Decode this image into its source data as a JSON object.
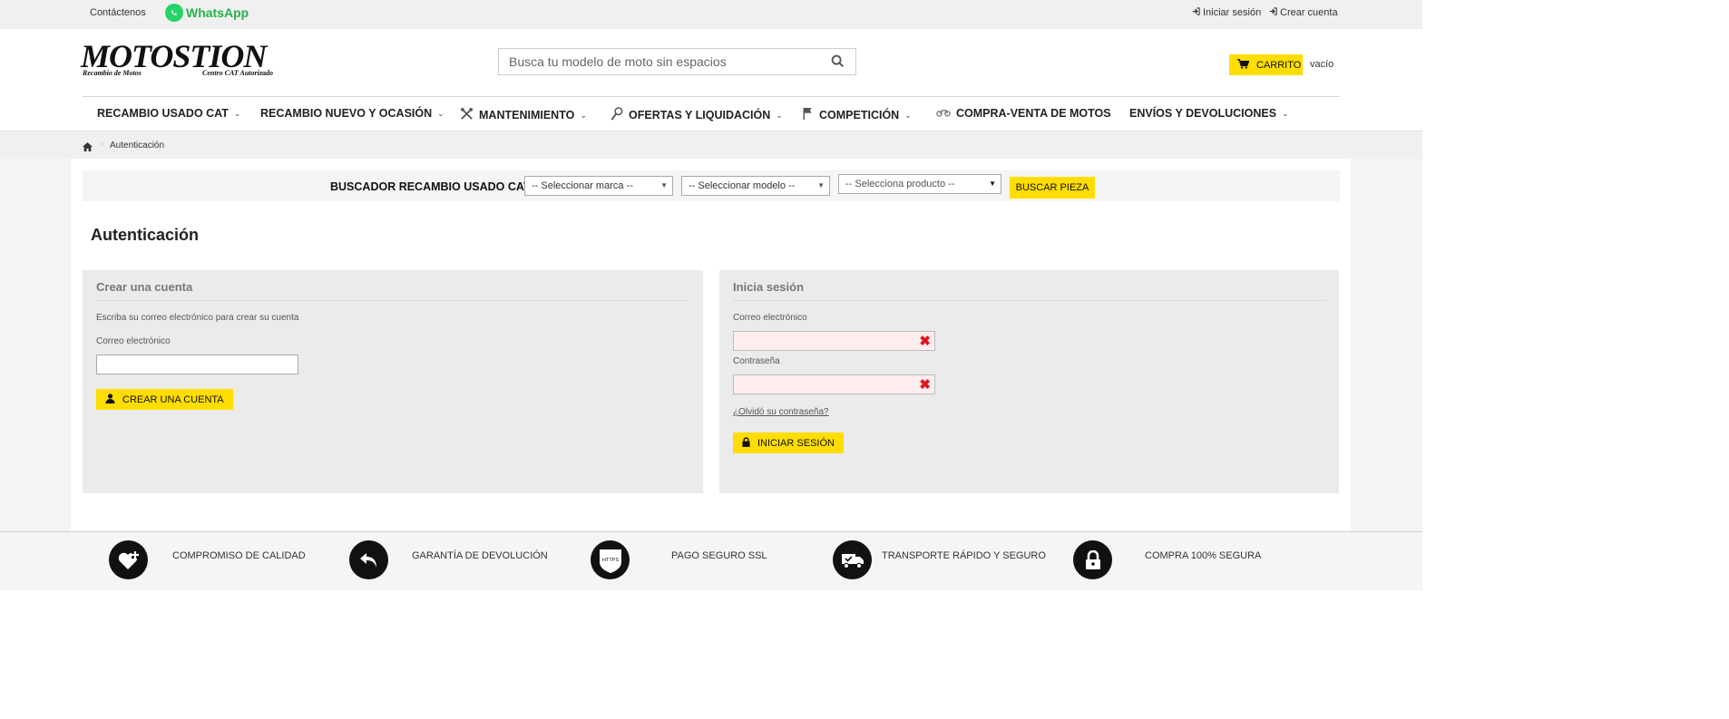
{
  "topbar": {
    "contact_label": "Contáctenos",
    "whatsapp_label": "WhatsApp",
    "login_label": "Iniciar sesión",
    "register_label": "Crear cuenta"
  },
  "header": {
    "logo_text": "MOTOSTION",
    "logo_tagline_left": "Recambio de Motos",
    "logo_tagline_right": "Centro CAT Autorizado",
    "search_placeholder": "Busca tu modelo de moto sin espacios",
    "cart_label": "CARRITO",
    "cart_status": "vacío"
  },
  "nav": {
    "items": [
      {
        "label": "RECAMBIO USADO CAT",
        "icon": "",
        "dropdown": true
      },
      {
        "label": "RECAMBIO NUEVO Y OCASIÓN",
        "icon": "",
        "dropdown": true
      },
      {
        "label": "MANTENIMIENTO",
        "icon": "tools-icon",
        "dropdown": true
      },
      {
        "label": "OFERTAS Y LIQUIDACIÓN",
        "icon": "tag-icon",
        "dropdown": true
      },
      {
        "label": "COMPETICIÓN",
        "icon": "flag-icon",
        "dropdown": true
      },
      {
        "label": "COMPRA-VENTA DE MOTOS",
        "icon": "motorcycle-icon",
        "dropdown": false
      },
      {
        "label": "ENVÍOS Y DEVOLUCIONES",
        "icon": "",
        "dropdown": true
      }
    ]
  },
  "breadcrumb": {
    "current": "Autenticación"
  },
  "finder": {
    "label": "BUSCADOR RECAMBIO USADO CAT:",
    "brand_select": "-- Seleccionar marca --",
    "model_select": "-- Seleccionar modelo --",
    "product_select": "-- Selecciona producto --",
    "button_label": "BUSCAR PIEZA"
  },
  "page": {
    "title": "Autenticación"
  },
  "create_account": {
    "heading": "Crear una cuenta",
    "intro": "Escriba su correo electrónico para crear su cuenta",
    "email_label": "Correo electrónico",
    "email_value": "",
    "button_label": "CREAR UNA CUENTA"
  },
  "login": {
    "heading": "Inicia sesión",
    "email_label": "Correo electrónico",
    "email_value": "",
    "password_label": "Contraseña",
    "password_value": "",
    "forgot_label": "¿Olvidó su contraseña?",
    "button_label": "INICIAR SESIÓN",
    "field_error_color": "#e0161e"
  },
  "footer": {
    "features": [
      {
        "label": "COMPROMISO DE CALIDAD",
        "icon": "heart-plus-icon"
      },
      {
        "label": "GARANTÍA DE DEVOLUCIÓN",
        "icon": "return-arrow-icon"
      },
      {
        "label": "PAGO SEGURO SSL",
        "icon": "https-shield-icon"
      },
      {
        "label": "TRANSPORTE RÁPIDO Y SEGURO",
        "icon": "delivery-truck-icon"
      },
      {
        "label": "COMPRA 100% SEGURA",
        "icon": "padlock-icon"
      }
    ],
    "https_badge_text": "HTTPS"
  },
  "colors": {
    "accent": "#ffdd00",
    "whatsapp": "#25d366",
    "error": "#e0161e"
  }
}
